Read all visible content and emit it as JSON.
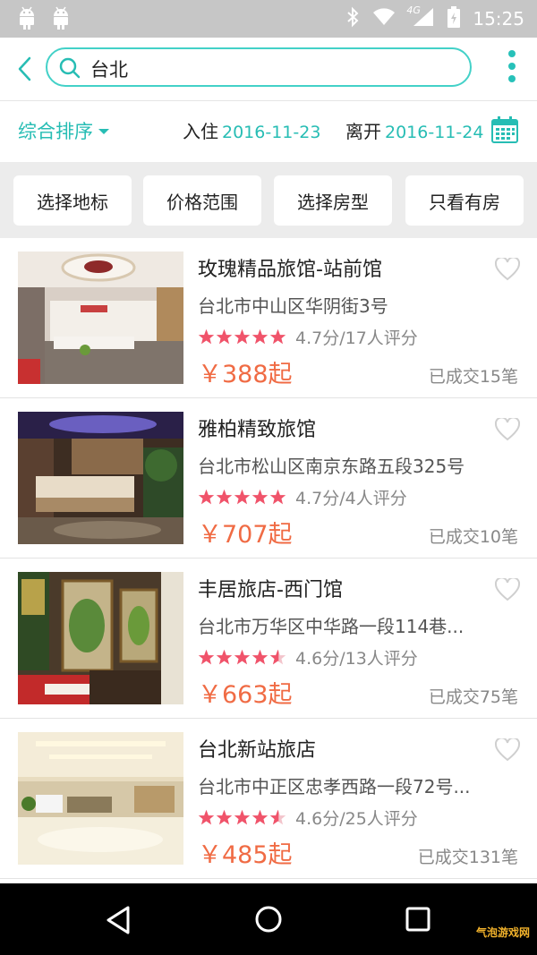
{
  "status_bar": {
    "time": "15:25",
    "network_label": "4G",
    "icons": [
      "android-notification-icon",
      "android-notification-icon",
      "bluetooth-icon",
      "wifi-icon",
      "signal-icon",
      "battery-icon"
    ]
  },
  "search": {
    "query": "台北"
  },
  "sort_bar": {
    "sort_label": "综合排序",
    "checkin_label": "入住",
    "checkin_date": "2016-11-23",
    "checkout_label": "离开",
    "checkout_date": "2016-11-24"
  },
  "filters": [
    {
      "label": "选择地标"
    },
    {
      "label": "价格范围"
    },
    {
      "label": "选择房型"
    },
    {
      "label": "只看有房"
    }
  ],
  "hotels": [
    {
      "name": "玫瑰精品旅馆-站前馆",
      "address": "台北市中山区华阴街3号",
      "rating_text": "4.7分/17人评分",
      "rating": 4.7,
      "price": "￥388起",
      "sold": "已成交15笔"
    },
    {
      "name": "雅柏精致旅馆",
      "address": "台北市松山区南京东路五段325号",
      "rating_text": "4.7分/4人评分",
      "rating": 4.7,
      "price": "￥707起",
      "sold": "已成交10笔"
    },
    {
      "name": "丰居旅店-西门馆",
      "address": "台北市万华区中华路一段114巷...",
      "rating_text": "4.6分/13人评分",
      "rating": 4.6,
      "price": "￥663起",
      "sold": "已成交75笔"
    },
    {
      "name": "台北新站旅店",
      "address": "台北市中正区忠孝西路一段72号...",
      "rating_text": "4.6分/25人评分",
      "rating": 4.6,
      "price": "￥485起",
      "sold": "已成交131笔"
    }
  ],
  "colors": {
    "accent": "#27bdb4",
    "price": "#f06b44",
    "star": "#f0536a",
    "status_bar": "#c6c6c6"
  },
  "watermark": "气泡游戏网"
}
